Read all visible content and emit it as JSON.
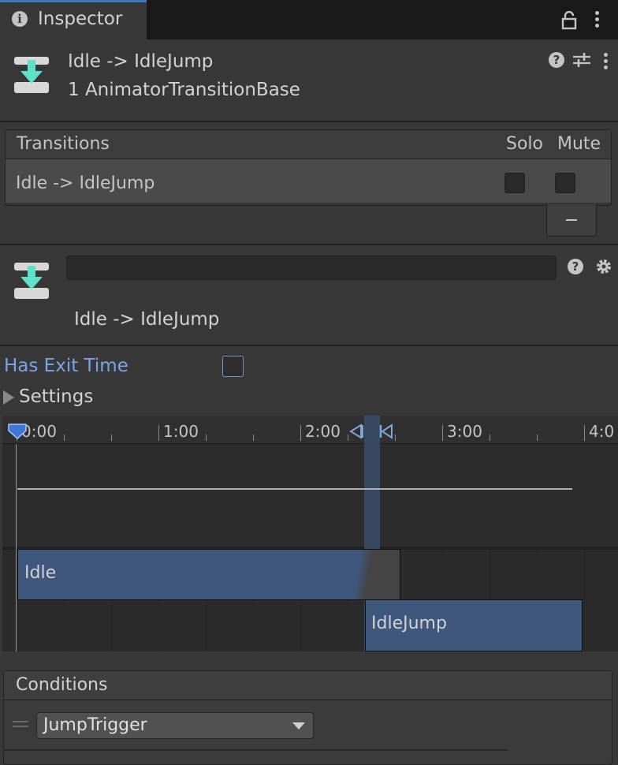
{
  "tab": {
    "title": "Inspector"
  },
  "header": {
    "title": "Idle -> IdleJump",
    "subtitle": "1 AnimatorTransitionBase"
  },
  "transitions_list": {
    "header": {
      "label": "Transitions",
      "solo": "Solo",
      "mute": "Mute"
    },
    "rows": [
      {
        "name": "Idle -> IdleJump",
        "solo": false,
        "mute": false
      }
    ]
  },
  "transition": {
    "name_value": "",
    "label": "Idle -> IdleJump"
  },
  "has_exit_time": {
    "label": "Has Exit Time",
    "checked": false
  },
  "settings": {
    "label": "Settings"
  },
  "timeline": {
    "ruler_labels": [
      "0:00",
      "1:00",
      "2:00",
      "3:00",
      "4:0"
    ],
    "states": [
      {
        "name": "Idle"
      },
      {
        "name": "IdleJump"
      }
    ]
  },
  "conditions": {
    "label": "Conditions",
    "items": [
      {
        "parameter": "JumpTrigger"
      }
    ]
  },
  "colors": {
    "accent_blue": "#3a79bb",
    "state_bar": "#3f577d",
    "link_text": "#7aa5e6"
  },
  "icons": [
    "info-icon",
    "lock-icon",
    "kebab-menu-icon",
    "help-icon",
    "preset-sliders-icon",
    "transition-arrow-icon",
    "gear-icon",
    "expand-triangle-icon",
    "dropdown-arrow-icon",
    "drag-handle-icon"
  ]
}
